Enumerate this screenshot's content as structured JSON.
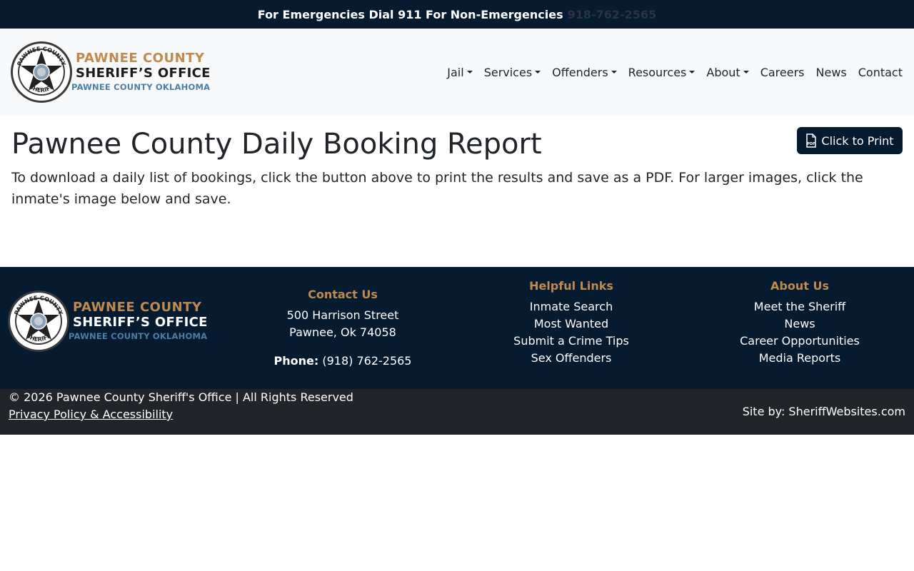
{
  "alert": {
    "text": "For Emergencies Dial 911 For Non-Emergencies",
    "phone": "918-762-2565"
  },
  "logo": {
    "line1": "PAWNEE COUNTY",
    "line2": "SHERIFF’S OFFICE",
    "line3": "PAWNEE COUNTY OKLAHOMA",
    "badge_top": "PAWNEE COUNTY",
    "badge_bottom": "SHERIFF"
  },
  "nav": {
    "items": [
      {
        "label": "Jail",
        "dropdown": true
      },
      {
        "label": "Services",
        "dropdown": true
      },
      {
        "label": "Offenders",
        "dropdown": true
      },
      {
        "label": "Resources",
        "dropdown": true
      },
      {
        "label": "About",
        "dropdown": true
      },
      {
        "label": "Careers",
        "dropdown": false
      },
      {
        "label": "News",
        "dropdown": false
      },
      {
        "label": "Contact",
        "dropdown": false
      }
    ]
  },
  "main": {
    "title": "Pawnee County Daily Booking Report",
    "intro": "To download a daily list of bookings, click the button above to print the results and save as a PDF. For larger images, click the inmate's image below and save.",
    "print_button": "Click to Print",
    "print_icon": "pdf-file-icon"
  },
  "footer": {
    "contact": {
      "heading": "Contact Us",
      "address1": "500 Harrison Street",
      "address2": "Pawnee, Ok 74058",
      "phone_label": "Phone:",
      "phone": "(918) 762-2565"
    },
    "helpful": {
      "heading": "Helpful Links",
      "links": [
        "Inmate Search",
        "Most Wanted",
        "Submit a Crime Tips",
        "Sex Offenders"
      ]
    },
    "about": {
      "heading": "About Us",
      "links": [
        "Meet the Sheriff",
        "News",
        "Career Opportunities",
        "Media Reports"
      ]
    }
  },
  "copyright": {
    "text": "© 2026 Pawnee County Sheriff's Office | All Rights Reserved",
    "privacy": "Privacy Policy & Accessibility",
    "site_by": "Site by: SheriffWebsites.com"
  },
  "colors": {
    "navy": "#061a30",
    "gold": "#c08a4e",
    "blue": "#4d7fa3",
    "dark": "#212529"
  }
}
